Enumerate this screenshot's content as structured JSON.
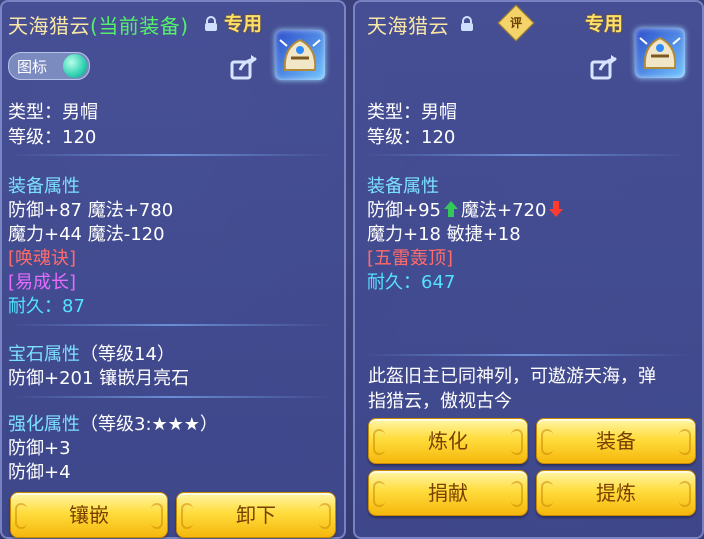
{
  "left_panel": {
    "title": "天海猎云",
    "title_suffix": "(当前装备)",
    "exclusive_label": "专用",
    "icon_toggle_label": "图标",
    "type": "类型：男帽",
    "level": "等级：120",
    "equip_attr_heading": "装备属性",
    "attr_line_1": "防御+87 魔法+780",
    "attr_line_2": "魔力+44 魔法-120",
    "special_1": "[唤魂诀]",
    "special_2": "[易成长]",
    "durability_label": "耐久：",
    "durability_value": "87",
    "gem_heading": "宝石属性",
    "gem_level": "（等级14）",
    "gem_line": "防御+201 镶嵌月亮石",
    "enhance_heading": "强化属性",
    "enhance_level": "（等级3:★★★）",
    "enhance_line_1": "防御+3",
    "enhance_line_2": "防御+4",
    "buttons": {
      "inlay": "镶嵌",
      "unequip": "卸下"
    }
  },
  "right_panel": {
    "title": "天海猎云",
    "rate_label": "评",
    "exclusive_label": "专用",
    "type": "类型：男帽",
    "level": "等级：120",
    "equip_attr_heading": "装备属性",
    "attr_def": "防御+95",
    "attr_mp": "魔法+720",
    "attr_line_2": "魔力+18 敏捷+18",
    "special_1": "[五雷轰顶]",
    "durability_label": "耐久：",
    "durability_value": "647",
    "desc_line_1": "此盔旧主已同神列，可遨游天海，弹",
    "desc_line_2": "指猎云，傲视古今",
    "buttons": {
      "refine": "炼化",
      "equip": "装备",
      "donate": "捐献",
      "extract": "提炼"
    }
  },
  "colors": {
    "title": "#fbe8a6",
    "current_equipped": "#54f06b",
    "heading": "#7ce0ff",
    "special_red": "#ff6b6b",
    "special_purple": "#e66bff",
    "durability": "#54e1ff",
    "button_text": "#7a3f00",
    "increase_arrow": "#34c759",
    "decrease_arrow": "#ff3b30"
  }
}
